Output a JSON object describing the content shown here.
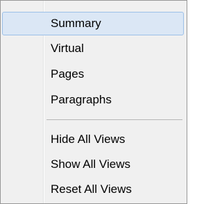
{
  "menu": {
    "items": [
      {
        "label": "Summary",
        "selected": true
      },
      {
        "label": "Virtual",
        "selected": false
      },
      {
        "label": "Pages",
        "selected": false
      },
      {
        "label": "Paragraphs",
        "selected": false
      }
    ],
    "view_actions": [
      {
        "label": "Hide All Views"
      },
      {
        "label": "Show All Views"
      },
      {
        "label": "Reset All Views"
      }
    ]
  },
  "colors": {
    "menu_background": "#f0f0f0",
    "selection_fill": "#dbe7f5",
    "selection_border": "#9bbfe8",
    "border": "#979797",
    "separator": "#b5b5b5"
  }
}
